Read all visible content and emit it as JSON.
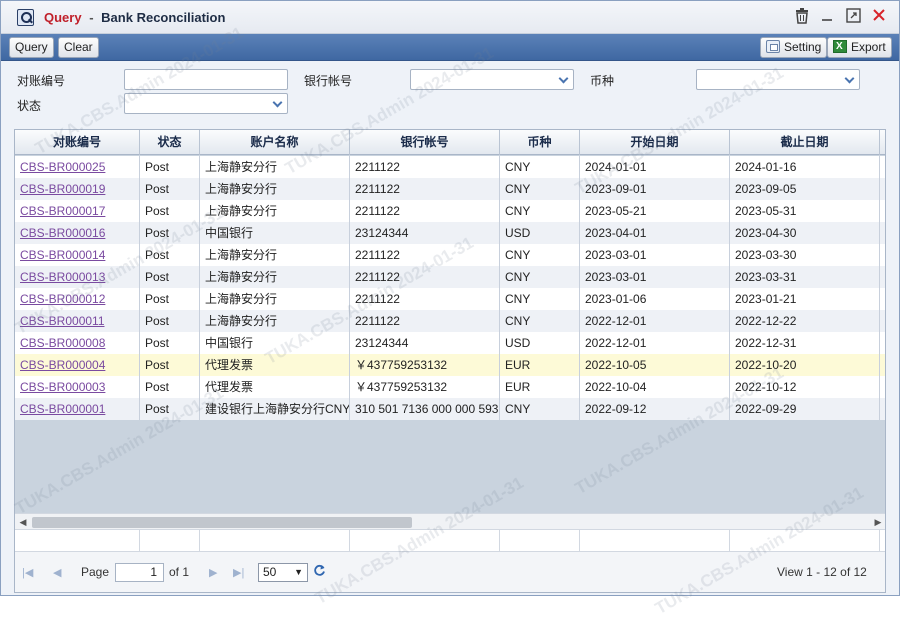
{
  "window": {
    "title_query": "Query",
    "title_sep": "-",
    "title_name": "Bank Reconciliation"
  },
  "toolbar": {
    "query_label": "Query",
    "clear_label": "Clear",
    "setting_label": "Setting",
    "export_label": "Export"
  },
  "filters": {
    "recon_no_label": "对账编号",
    "recon_no_value": "",
    "account_no_label": "银行帐号",
    "account_no_value": "",
    "currency_label": "币种",
    "currency_value": "",
    "status_label": "状态",
    "status_value": ""
  },
  "grid": {
    "columns": [
      "对账编号",
      "状态",
      "账户名称",
      "银行帐号",
      "币种",
      "开始日期",
      "截止日期"
    ],
    "rows": [
      [
        "CBS-BR000025",
        "Post",
        "上海静安分行",
        "2211122",
        "CNY",
        "2024-01-01",
        "2024-01-16"
      ],
      [
        "CBS-BR000019",
        "Post",
        "上海静安分行",
        "2211122",
        "CNY",
        "2023-09-01",
        "2023-09-05"
      ],
      [
        "CBS-BR000017",
        "Post",
        "上海静安分行",
        "2211122",
        "CNY",
        "2023-05-21",
        "2023-05-31"
      ],
      [
        "CBS-BR000016",
        "Post",
        "中国银行",
        "23124344",
        "USD",
        "2023-04-01",
        "2023-04-30"
      ],
      [
        "CBS-BR000014",
        "Post",
        "上海静安分行",
        "2211122",
        "CNY",
        "2023-03-01",
        "2023-03-30"
      ],
      [
        "CBS-BR000013",
        "Post",
        "上海静安分行",
        "2211122",
        "CNY",
        "2023-03-01",
        "2023-03-31"
      ],
      [
        "CBS-BR000012",
        "Post",
        "上海静安分行",
        "2211122",
        "CNY",
        "2023-01-06",
        "2023-01-21"
      ],
      [
        "CBS-BR000011",
        "Post",
        "上海静安分行",
        "2211122",
        "CNY",
        "2022-12-01",
        "2022-12-22"
      ],
      [
        "CBS-BR000008",
        "Post",
        "中国银行",
        "23124344",
        "USD",
        "2022-12-01",
        "2022-12-31"
      ],
      [
        "CBS-BR000004",
        "Post",
        "代理发票",
        "￥437759253132",
        "EUR",
        "2022-10-05",
        "2022-10-20"
      ],
      [
        "CBS-BR000003",
        "Post",
        "代理发票",
        "￥437759253132",
        "EUR",
        "2022-10-04",
        "2022-10-12"
      ],
      [
        "CBS-BR000001",
        "Post",
        "建设银行上海静安分行CNY",
        "310 501 7136 000 000 593",
        "CNY",
        "2022-09-12",
        "2022-09-29"
      ]
    ]
  },
  "pager": {
    "page_label": "Page",
    "page_value": "1",
    "of_label": "of 1",
    "page_size": "50",
    "view_text": "View 1 - 12 of 12"
  },
  "watermark": "TUKA.CBS.Admin 2024-01-31",
  "colors": {
    "toolbar": "#4a72ab",
    "title_red": "#c0202a",
    "link": "#7a4aa0",
    "highlight_row": "#fdfad7"
  }
}
